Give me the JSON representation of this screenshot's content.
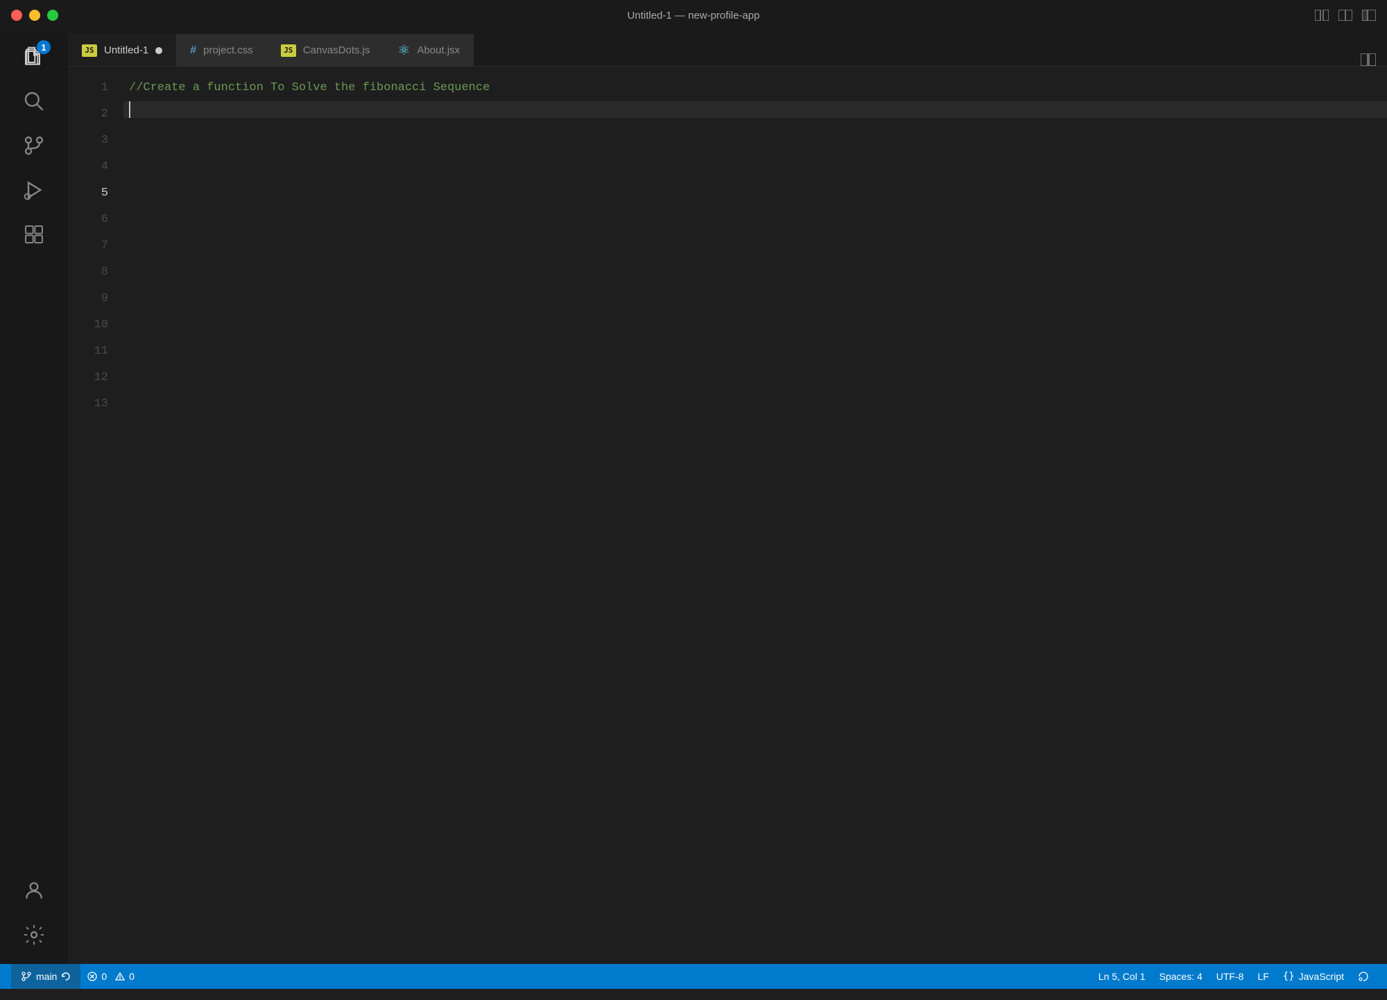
{
  "titlebar": {
    "title": "Untitled-1 — new-profile-app",
    "traffic_lights": [
      "red",
      "yellow",
      "green"
    ]
  },
  "tabs": [
    {
      "id": "untitled1",
      "label": "Untitled-1",
      "type": "js",
      "active": true,
      "modified": true
    },
    {
      "id": "projectcss",
      "label": "project.css",
      "type": "css",
      "active": false,
      "modified": false
    },
    {
      "id": "canvasdots",
      "label": "CanvasDots.js",
      "type": "js",
      "active": false,
      "modified": false
    },
    {
      "id": "aboutjsx",
      "label": "About.jsx",
      "type": "jsx",
      "active": false,
      "modified": false
    }
  ],
  "editor": {
    "lines": [
      {
        "num": 1,
        "content": "",
        "type": "empty"
      },
      {
        "num": 2,
        "content": "",
        "type": "empty"
      },
      {
        "num": 3,
        "content": "",
        "type": "empty"
      },
      {
        "num": 4,
        "content": "//Create a function To Solve the fibonacci Sequence",
        "type": "comment"
      },
      {
        "num": 5,
        "content": "",
        "type": "cursor-line"
      },
      {
        "num": 6,
        "content": "",
        "type": "empty"
      },
      {
        "num": 7,
        "content": "",
        "type": "empty"
      },
      {
        "num": 8,
        "content": "",
        "type": "empty"
      },
      {
        "num": 9,
        "content": "",
        "type": "empty"
      },
      {
        "num": 10,
        "content": "",
        "type": "empty"
      },
      {
        "num": 11,
        "content": "",
        "type": "empty"
      },
      {
        "num": 12,
        "content": "",
        "type": "empty"
      },
      {
        "num": 13,
        "content": "",
        "type": "empty"
      }
    ]
  },
  "activity_bar": {
    "items": [
      {
        "id": "explorer",
        "icon": "files",
        "badge": 1
      },
      {
        "id": "search",
        "icon": "search",
        "badge": null
      },
      {
        "id": "source-control",
        "icon": "source-control",
        "badge": null
      },
      {
        "id": "run",
        "icon": "run",
        "badge": null
      },
      {
        "id": "extensions",
        "icon": "extensions",
        "badge": null
      }
    ],
    "bottom_items": [
      {
        "id": "account",
        "icon": "account",
        "badge": null
      },
      {
        "id": "settings",
        "icon": "settings",
        "badge": null
      }
    ]
  },
  "status_bar": {
    "branch": "main",
    "errors": "0",
    "warnings": "0",
    "position": "Ln 5, Col 1",
    "spaces": "Spaces: 4",
    "encoding": "UTF-8",
    "line_ending": "LF",
    "language": "JavaScript"
  }
}
